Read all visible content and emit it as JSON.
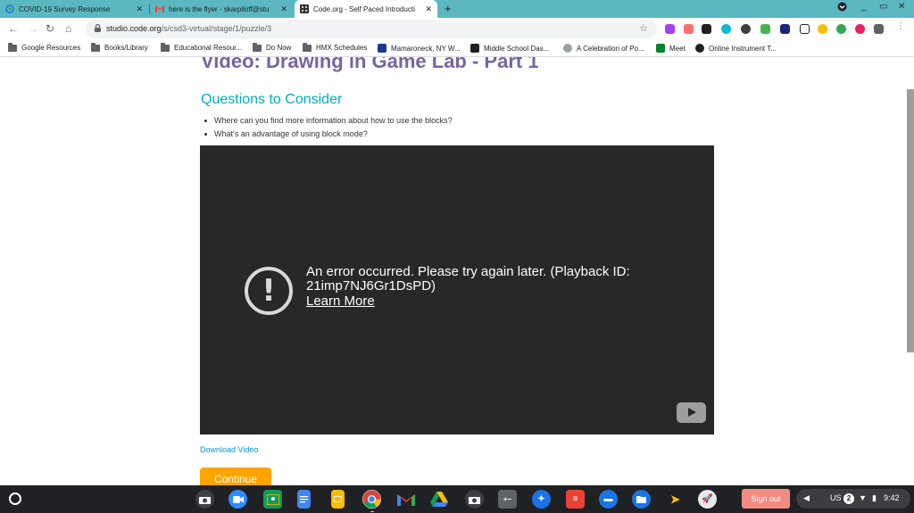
{
  "browser": {
    "tabs": [
      {
        "title": "COVID-19 Survey Response",
        "icon": "survey-icon"
      },
      {
        "title": "here is the flyer - skarpiloff@stu",
        "icon": "gmail-icon"
      },
      {
        "title": "Code.org - Self Paced Introducti",
        "icon": "codeorg-icon",
        "active": true
      }
    ],
    "address": {
      "host": "studio.code.org",
      "path": "/s/csd3-virtual/stage/1/puzzle/3"
    }
  },
  "bookmarks": [
    {
      "label": "Google Resources",
      "icon": "folder-icon"
    },
    {
      "label": "Books/Library",
      "icon": "folder-icon"
    },
    {
      "label": "Educational Resour...",
      "icon": "folder-icon"
    },
    {
      "label": "Do Now",
      "icon": "folder-icon"
    },
    {
      "label": "HMX Schedules",
      "icon": "folder-icon"
    },
    {
      "label": "Mamaroneck, NY W...",
      "icon": "site-icon"
    },
    {
      "label": "Middle School Das...",
      "icon": "site-icon"
    },
    {
      "label": "A Celebration of Po...",
      "icon": "site-icon"
    },
    {
      "label": "Meet",
      "icon": "meet-icon"
    },
    {
      "label": "Online Instrument T...",
      "icon": "site-icon"
    }
  ],
  "lesson": {
    "title": "Video: Drawing in Game Lab - Part 1",
    "questions_heading": "Questions to Consider",
    "questions": [
      "Where can you find more information about how to use the blocks?",
      "What's an advantage of using block mode?"
    ],
    "video_error": "An error occurred. Please try again later. (Playback ID: 21imp7NJ6Gr1DsPD)",
    "learn_more": "Learn More",
    "download_label": "Download Video",
    "continue_label": "Continue"
  },
  "shelf": {
    "sign_out": "Sign out",
    "locale": "US",
    "notifications": "2",
    "time": "9:42"
  },
  "colors": {
    "tab_strip": "#5bb8c0",
    "lesson_title": "#7665a0",
    "questions_heading": "#00adbc",
    "continue_button": "#ffa400",
    "sign_out": "#f28b82"
  }
}
